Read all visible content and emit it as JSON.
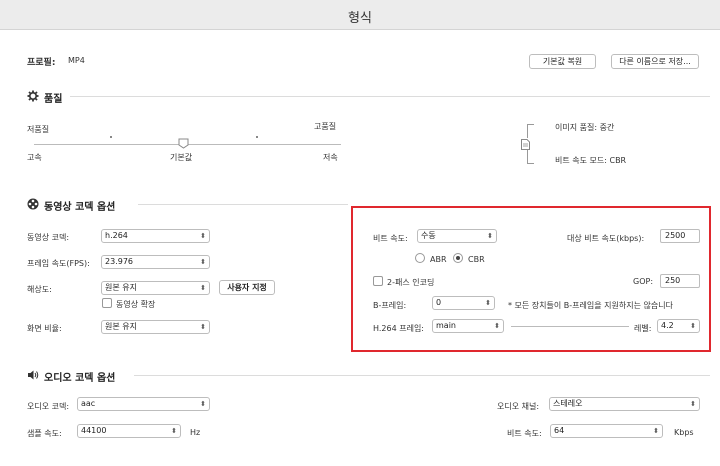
{
  "window": {
    "title": "형식"
  },
  "profile": {
    "label": "프로필:",
    "value": "MP4"
  },
  "buttons": {
    "restore_default": "기본값 복원",
    "save_as": "다른 이름으로 저장..."
  },
  "quality": {
    "title": "품질",
    "low_quality": "저품질",
    "high_quality": "고품질",
    "fast": "고속",
    "default": "기본값",
    "slow": "저속",
    "image_quality": "이미지 품질: 중간",
    "bitrate_mode": "비트 속도 모드: CBR"
  },
  "video": {
    "title": "동영상 코덱 옵션",
    "codec_label": "동영상 코덱:",
    "codec_value": "h.264",
    "fps_label": "프레임 속도(FPS):",
    "fps_value": "23.976",
    "resolution_label": "해상도:",
    "resolution_value": "원본 유지",
    "custom_button": "사용자 지정",
    "upscale_label": "동영상 확장",
    "aspect_label": "화면 비율:",
    "aspect_value": "원본 유지",
    "bitrate_label": "비트 속도:",
    "bitrate_value": "수동",
    "target_bitrate_label": "대상 비트 속도(kbps):",
    "target_bitrate_value": "2500",
    "abr": "ABR",
    "cbr": "CBR",
    "twopass_label": "2-패스 인코딩",
    "gop_label": "GOP:",
    "gop_value": "250",
    "bframe_label": "B-프레임:",
    "bframe_value": "0",
    "bframe_note": "* 모든 장치들이 B-프레임을 지원하지는 않습니다",
    "h264_profile_label": "H.264 프레임:",
    "h264_profile_value": "main",
    "level_label": "레벨:",
    "level_value": "4.2"
  },
  "audio": {
    "title": "오디오 코덱 옵션",
    "codec_label": "오디오 코덱:",
    "codec_value": "aac",
    "channel_label": "오디오 채널:",
    "channel_value": "스테레오",
    "samplerate_label": "샘플 속도:",
    "samplerate_value": "44100",
    "hz": "Hz",
    "bitrate_label": "비트 속도:",
    "bitrate_value": "64",
    "kbps": "Kbps"
  },
  "colors": {
    "highlight": "#e0282e"
  }
}
